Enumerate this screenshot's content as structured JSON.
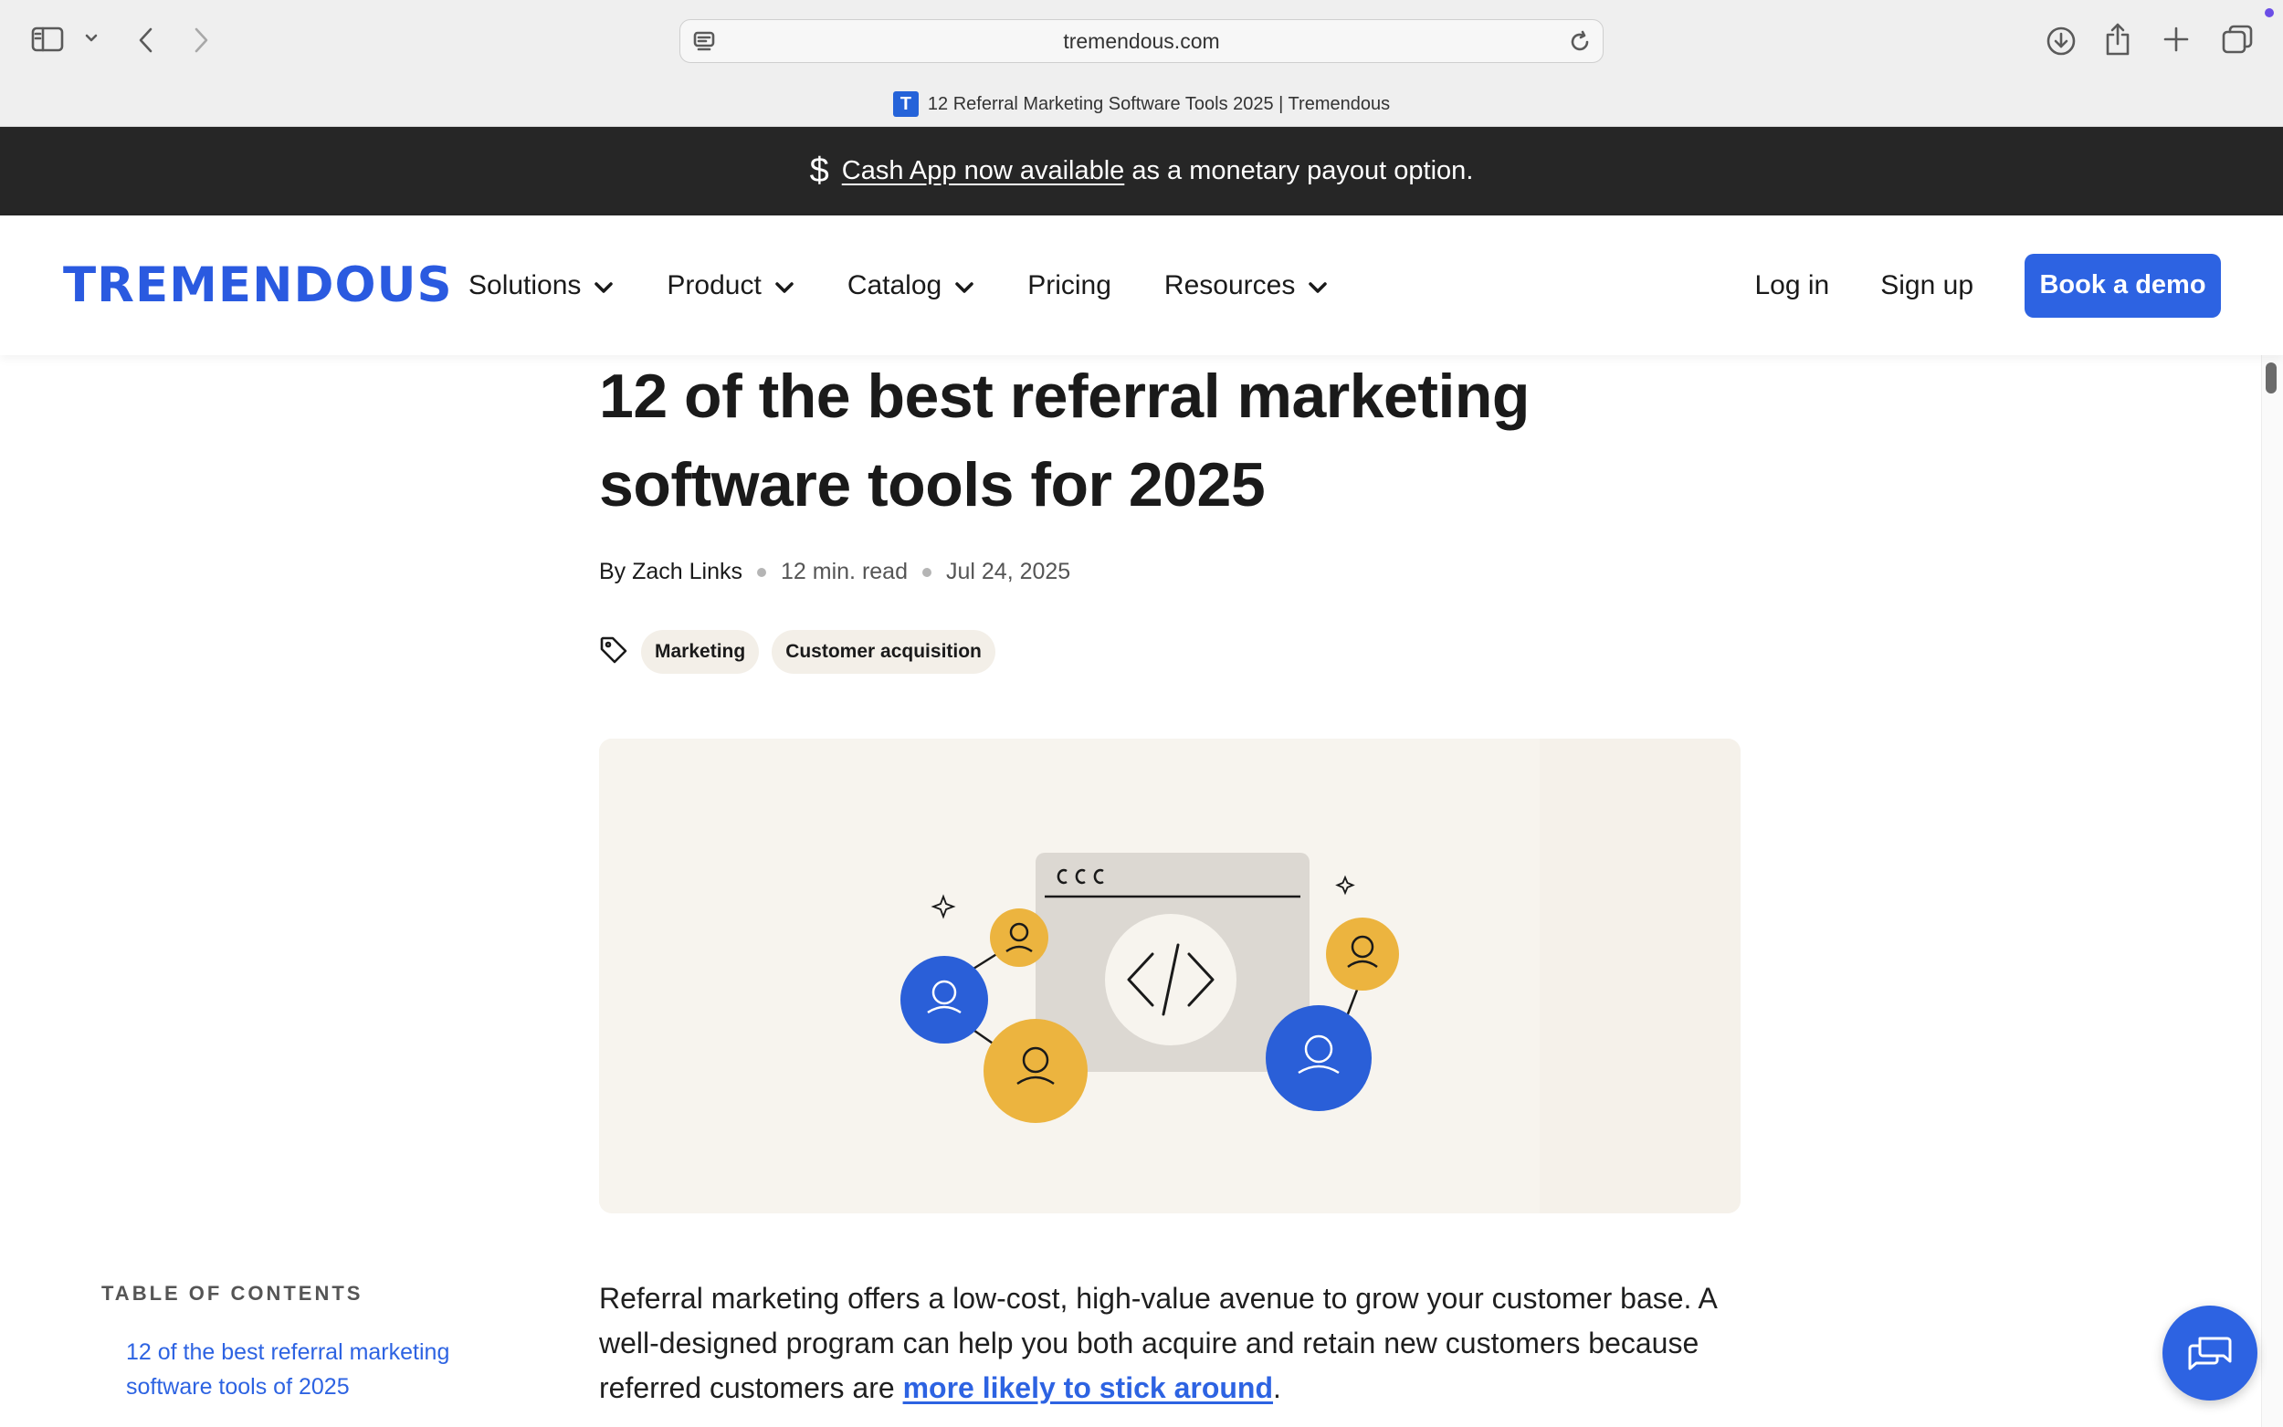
{
  "browser": {
    "url": "tremendous.com",
    "tab_title": "12 Referral Marketing Software Tools 2025 | Tremendous",
    "favicon_letter": "T",
    "icons": [
      "sidebar-icon",
      "chevron-down-icon",
      "back-icon",
      "forward-icon",
      "page-icon",
      "reload-icon",
      "download-icon",
      "share-icon",
      "new-tab-icon",
      "tabs-overview-icon"
    ]
  },
  "announcement": {
    "icon": "dollar-icon",
    "link_text": "Cash App now available",
    "rest_text": "as a monetary payout option."
  },
  "header": {
    "logo": "TREMENDOUS",
    "nav": [
      {
        "label": "Solutions",
        "has_dropdown": true
      },
      {
        "label": "Product",
        "has_dropdown": true
      },
      {
        "label": "Catalog",
        "has_dropdown": true
      },
      {
        "label": "Pricing",
        "has_dropdown": false
      },
      {
        "label": "Resources",
        "has_dropdown": true
      }
    ],
    "login": "Log in",
    "signup": "Sign up",
    "demo": "Book a demo"
  },
  "article": {
    "title": "12 of the best referral marketing software tools for 2025",
    "author": "By Zach Links",
    "read_time": "12 min. read",
    "date": "Jul 24, 2025",
    "tags": [
      "Marketing",
      "Customer acquisition"
    ],
    "paragraph_start": "Referral marketing offers a low-cost, high-value avenue to grow your customer base. A well-designed program can help you both acquire and retain new customers because referred customers are ",
    "paragraph_link": "more likely to stick around",
    "paragraph_end": "."
  },
  "toc": {
    "heading": "TABLE OF CONTENTS",
    "items": [
      "12 of the best referral marketing software tools of 2025"
    ]
  },
  "colors": {
    "brand_blue": "#2d63e2",
    "announce_bg": "#262626",
    "hero_bg": "#f7f4ee",
    "illus_yellow": "#ecb43f",
    "illus_blue": "#2a5fd8"
  }
}
